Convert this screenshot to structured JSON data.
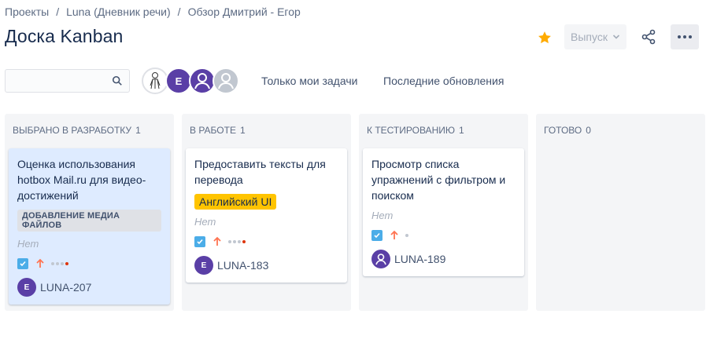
{
  "breadcrumb": {
    "items": [
      "Проекты",
      "Luna (Дневник речи)",
      "Обзор Дмитрий - Егор"
    ],
    "separator": "/"
  },
  "page": {
    "title": "Доска Kanban"
  },
  "header": {
    "release_label": "Выпуск",
    "star_color": "#ffab00"
  },
  "search": {
    "value": "",
    "placeholder": ""
  },
  "avatars": {
    "letter": "E"
  },
  "filters": {
    "mine": "Только мои задачи",
    "recent": "Последние обновления"
  },
  "columns": [
    {
      "title": "ВЫБРАНО В РАЗРАБОТКУ",
      "count": "1",
      "cards": [
        {
          "summary": "Оценка использования hotbox Mail.ru для видео-достижений",
          "epic": "ДОБАВЛЕНИЕ МЕДИА ФАЙЛОВ",
          "fix_version": "Нет",
          "key": "LUNA-207",
          "assignee": "E",
          "selected": true
        }
      ]
    },
    {
      "title": "В РАБОТЕ",
      "count": "1",
      "cards": [
        {
          "summary": "Предоставить тексты для перевода",
          "label": "Английский UI",
          "fix_version": "Нет",
          "key": "LUNA-183",
          "assignee": "E"
        }
      ]
    },
    {
      "title": "К ТЕСТИРОВАНИЮ",
      "count": "1",
      "cards": [
        {
          "summary": "Просмотр списка упражнений с фильтром и поиском",
          "fix_version": "Нет",
          "key": "LUNA-189",
          "assignee": "user-icon"
        }
      ]
    },
    {
      "title": "ГОТОВО",
      "count": "0",
      "cards": []
    }
  ],
  "colors": {
    "accent": "#5a3fa6",
    "label": "#ffc400",
    "priority": "#ff7452",
    "checkbox": "#4bade8"
  }
}
